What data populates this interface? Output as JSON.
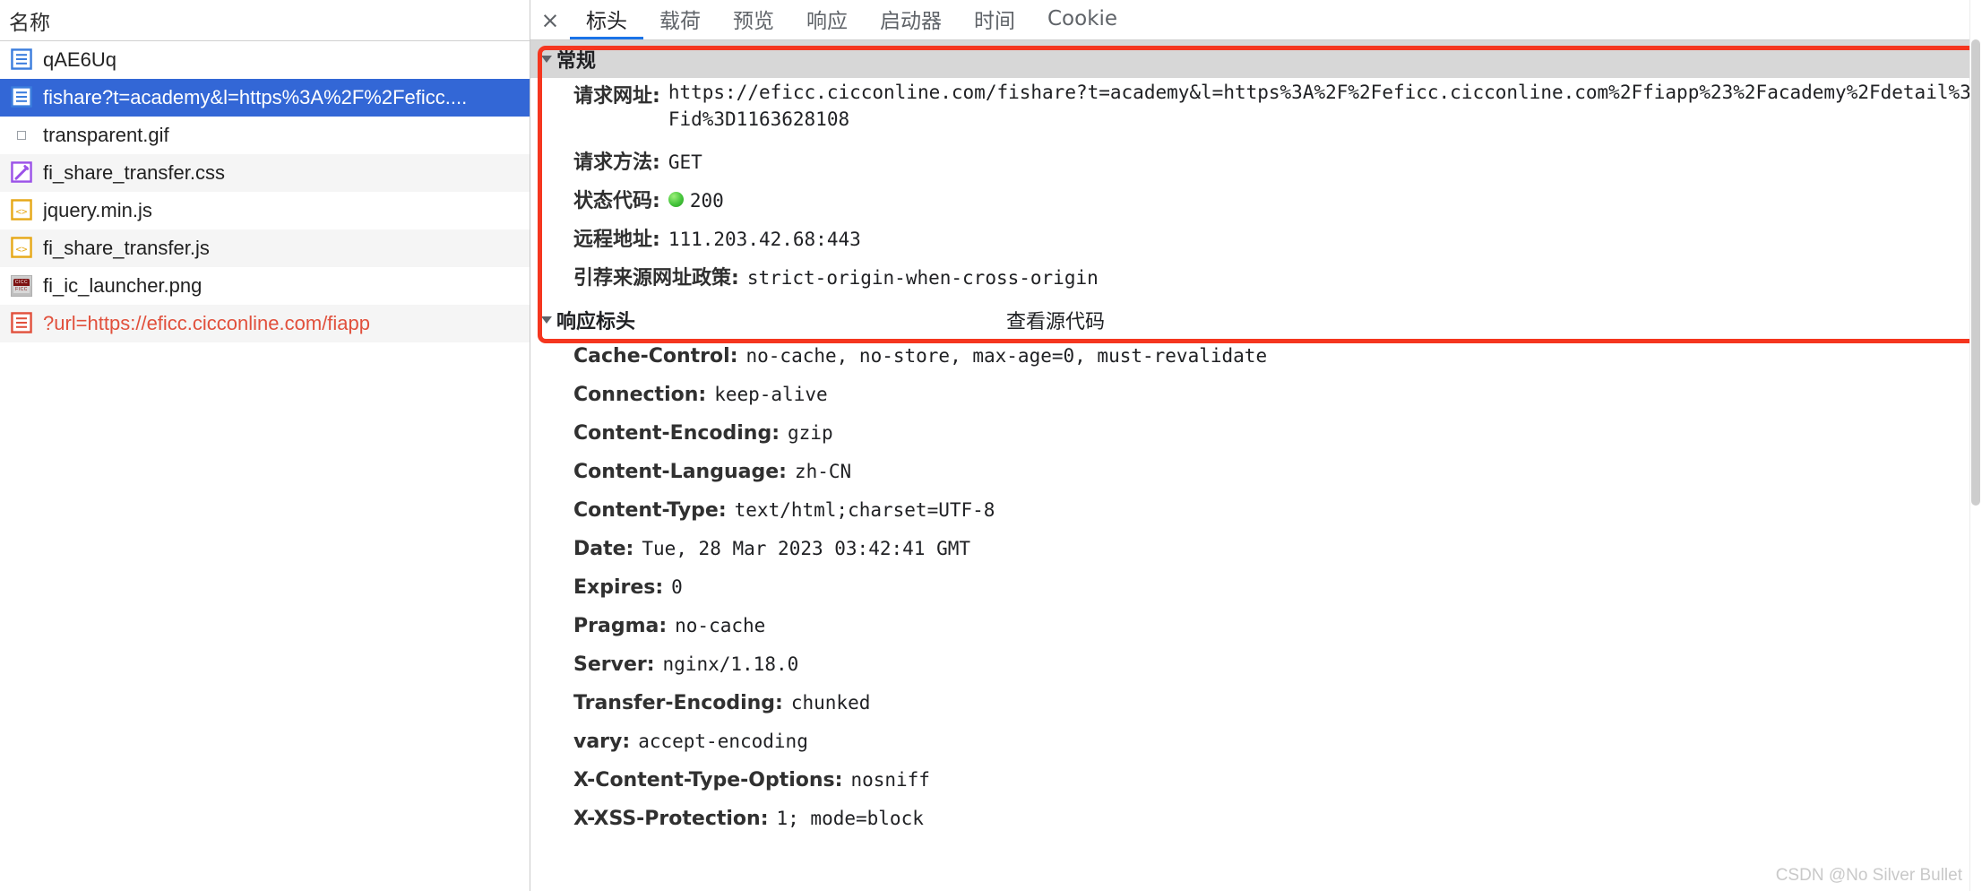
{
  "left_panel": {
    "column_header": "名称",
    "requests": [
      {
        "name": "qAE6Uq",
        "icon": "document-icon",
        "state": "normal"
      },
      {
        "name": "fishare?t=academy&l=https%3A%2F%2Feficc....",
        "icon": "document-icon",
        "state": "selected"
      },
      {
        "name": "transparent.gif",
        "icon": "image-small-icon",
        "state": "normal"
      },
      {
        "name": "fi_share_transfer.css",
        "icon": "stylesheet-icon",
        "state": "normal"
      },
      {
        "name": "jquery.min.js",
        "icon": "script-icon",
        "state": "normal"
      },
      {
        "name": "fi_share_transfer.js",
        "icon": "script-icon",
        "state": "normal"
      },
      {
        "name": "fi_ic_launcher.png",
        "icon": "png-thumbnail-icon",
        "state": "normal"
      },
      {
        "name": "?url=https://eficc.cicconline.com/fiapp",
        "icon": "document-error-icon",
        "state": "error"
      }
    ]
  },
  "tabbar": {
    "close_label": "×",
    "tabs": [
      {
        "label": "标头",
        "active": true
      },
      {
        "label": "载荷",
        "active": false
      },
      {
        "label": "预览",
        "active": false
      },
      {
        "label": "响应",
        "active": false
      },
      {
        "label": "启动器",
        "active": false
      },
      {
        "label": "时间",
        "active": false
      },
      {
        "label": "Cookie",
        "active": false
      }
    ]
  },
  "general": {
    "section_title": "常规",
    "rows": [
      {
        "key": "请求网址:",
        "value": "https://eficc.cicconline.com/fishare?t=academy&l=https%3A%2F%2Feficc.cicconline.com%2Ffiapp%23%2Facademy%2Fdetail%3Fid%3D1163628108"
      },
      {
        "key": "请求方法:",
        "value": "GET"
      },
      {
        "key": "状态代码:",
        "value": "200",
        "dot": true
      },
      {
        "key": "远程地址:",
        "value": "111.203.42.68:443"
      },
      {
        "key": "引荐来源网址政策:",
        "value": "strict-origin-when-cross-origin"
      }
    ]
  },
  "response_headers": {
    "section_title": "响应标头",
    "view_source_label": "查看源代码",
    "rows": [
      {
        "key": "Cache-Control:",
        "value": "no-cache, no-store, max-age=0, must-revalidate"
      },
      {
        "key": "Connection:",
        "value": "keep-alive"
      },
      {
        "key": "Content-Encoding:",
        "value": "gzip"
      },
      {
        "key": "Content-Language:",
        "value": "zh-CN"
      },
      {
        "key": "Content-Type:",
        "value": "text/html;charset=UTF-8"
      },
      {
        "key": "Date:",
        "value": "Tue, 28 Mar 2023 03:42:41 GMT"
      },
      {
        "key": "Expires:",
        "value": "0"
      },
      {
        "key": "Pragma:",
        "value": "no-cache"
      },
      {
        "key": "Server:",
        "value": "nginx/1.18.0"
      },
      {
        "key": "Transfer-Encoding:",
        "value": "chunked"
      },
      {
        "key": "vary:",
        "value": "accept-encoding"
      },
      {
        "key": "X-Content-Type-Options:",
        "value": "nosniff"
      },
      {
        "key": "X-XSS-Protection:",
        "value": "1; mode=block"
      }
    ]
  },
  "watermark": "CSDN @No Silver Bullet",
  "colors": {
    "selection_blue": "#3367d6",
    "error_red": "#e1503c",
    "annotation_red": "#f5361f",
    "tab_active_underline": "#1a73e8",
    "status_ok_green": "#45c43b",
    "section_header_bg": "#d7d7d7"
  }
}
